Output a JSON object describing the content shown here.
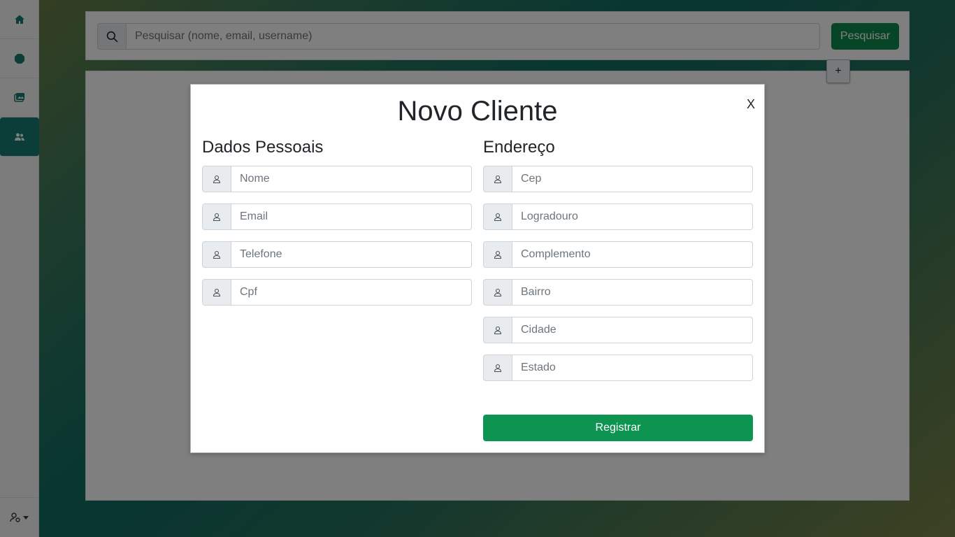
{
  "search": {
    "placeholder": "Pesquisar (nome, email, username)",
    "button_label": "Pesquisar"
  },
  "content": {
    "add_button_label": "+"
  },
  "sidebar": {
    "items": [
      {
        "icon": "home-icon"
      },
      {
        "icon": "box-icon"
      },
      {
        "icon": "gallery-icon"
      },
      {
        "icon": "users-icon",
        "active": true
      }
    ],
    "bottom_icon": "user-settings-icon"
  },
  "modal": {
    "title": "Novo Cliente",
    "close_label": "X",
    "personal": {
      "heading": "Dados Pessoais",
      "fields": [
        "Nome",
        "Email",
        "Telefone",
        "Cpf"
      ]
    },
    "address": {
      "heading": "Endereço",
      "fields": [
        "Cep",
        "Logradouro",
        "Complemento",
        "Bairro",
        "Cidade",
        "Estado"
      ]
    },
    "register_label": "Registrar"
  },
  "colors": {
    "accent": "#167d73",
    "primary_green": "#0d9451"
  }
}
